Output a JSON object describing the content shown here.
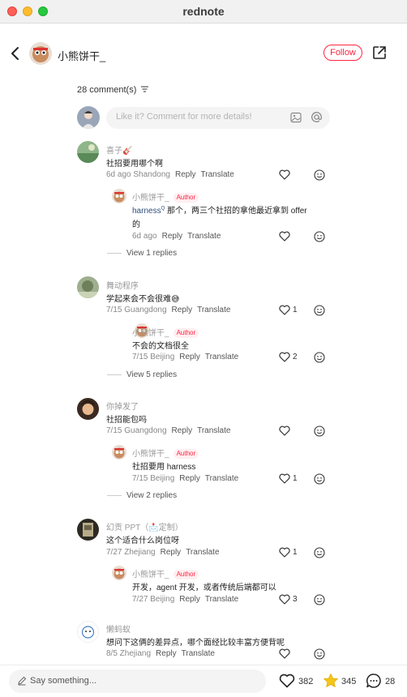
{
  "window": {
    "title": "rednote"
  },
  "header": {
    "author": "小熊饼干_",
    "follow_label": "Follow"
  },
  "comments_header": {
    "count_label": "28 comment(s)"
  },
  "comment_input": {
    "placeholder": "Like it? Comment for more details!"
  },
  "colors": {
    "accent": "#ff2442",
    "star": "#f5c518"
  },
  "threads": [
    {
      "user": "喜子🎸",
      "text": "社招要用哪个啊",
      "meta": "6d ago Shandong",
      "reply_label": "Reply",
      "translate_label": "Translate",
      "likes": "",
      "reply": {
        "user": "小熊饼干_",
        "badge": "Author",
        "mention": "harness",
        "text_line1": " 那个，两三个社招的拿他最近拿到 offer",
        "text_line2": "的",
        "meta": "6d ago",
        "reply_label": "Reply",
        "translate_label": "Translate",
        "likes": ""
      },
      "view_more": "View 1 replies"
    },
    {
      "user": "舞动程序",
      "text": "学起来会不会很难😅",
      "meta": "7/15 Guangdong",
      "reply_label": "Reply",
      "translate_label": "Translate",
      "likes": "1",
      "reply": {
        "user": "小熊饼干_",
        "badge": "Author",
        "text": "不会的文档很全",
        "meta": "7/15 Beijing",
        "reply_label": "Reply",
        "translate_label": "Translate",
        "likes": "2"
      },
      "view_more": "View 5 replies"
    },
    {
      "user": "你掉发了",
      "text": "社招能包吗",
      "meta": "7/15 Guangdong",
      "reply_label": "Reply",
      "translate_label": "Translate",
      "likes": "",
      "reply": {
        "user": "小熊饼干_",
        "badge": "Author",
        "text": "社招要用 harness",
        "meta": "7/15 Beijing",
        "reply_label": "Reply",
        "translate_label": "Translate",
        "likes": "1"
      },
      "view_more": "View 2 replies"
    },
    {
      "user": "幻贡 PPT（📩定制）",
      "text": "这个适合什么岗位呀",
      "meta": "7/27 Zhejiang",
      "reply_label": "Reply",
      "translate_label": "Translate",
      "likes": "1",
      "reply": {
        "user": "小熊饼干_",
        "badge": "Author",
        "text": "开发，agent 开发，或者传统后端都可以",
        "meta": "7/27 Beijing",
        "reply_label": "Reply",
        "translate_label": "Translate",
        "likes": "3"
      }
    },
    {
      "user": "懒蚂蚁",
      "text": "想问下这俩的差异点，哪个面经比较丰富方便背呢",
      "meta": "8/5 Zhejiang",
      "reply_label": "Reply",
      "translate_label": "Translate",
      "likes": ""
    }
  ],
  "bottom_bar": {
    "say_placeholder": "Say something...",
    "likes": "382",
    "stars": "345",
    "comments": "28"
  }
}
